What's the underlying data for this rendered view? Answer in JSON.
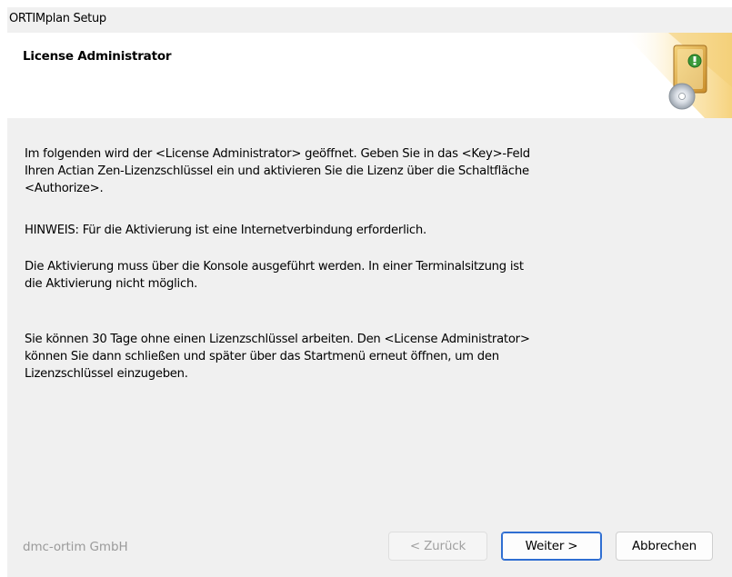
{
  "window": {
    "title": "ORTIMplan Setup"
  },
  "header": {
    "title": "License Administrator",
    "graphic_icon": "setup-box-cd-icon"
  },
  "content": {
    "paragraphs": [
      "Im folgenden wird der <License Administrator> geöffnet. Geben Sie in das <Key>-Feld\nIhren Actian Zen-Lizenzschlüssel ein und aktivieren Sie die Lizenz über die Schaltfläche\n<Authorize>.",
      "HINWEIS: Für die Aktivierung ist eine Internetverbindung erforderlich.",
      "Die Aktivierung muss über die Konsole ausgeführt werden. In einer Terminalsitzung ist\ndie Aktivierung nicht möglich.",
      "Sie können 30 Tage ohne einen Lizenzschlüssel arbeiten. Den <License Administrator>\nkönnen Sie dann schließen und später über das Startmenü erneut öffnen, um den\nLizenzschlüssel einzugeben."
    ]
  },
  "footer": {
    "brand": "dmc-ortim GmbH",
    "back_label": "< Zurück",
    "next_label": "Weiter >",
    "cancel_label": "Abbrechen"
  },
  "colors": {
    "accent": "#2f6ed2",
    "header_glow": "#f7d98a",
    "disabled_text": "#a0a0a0",
    "brand_text": "#9a9a9a"
  }
}
